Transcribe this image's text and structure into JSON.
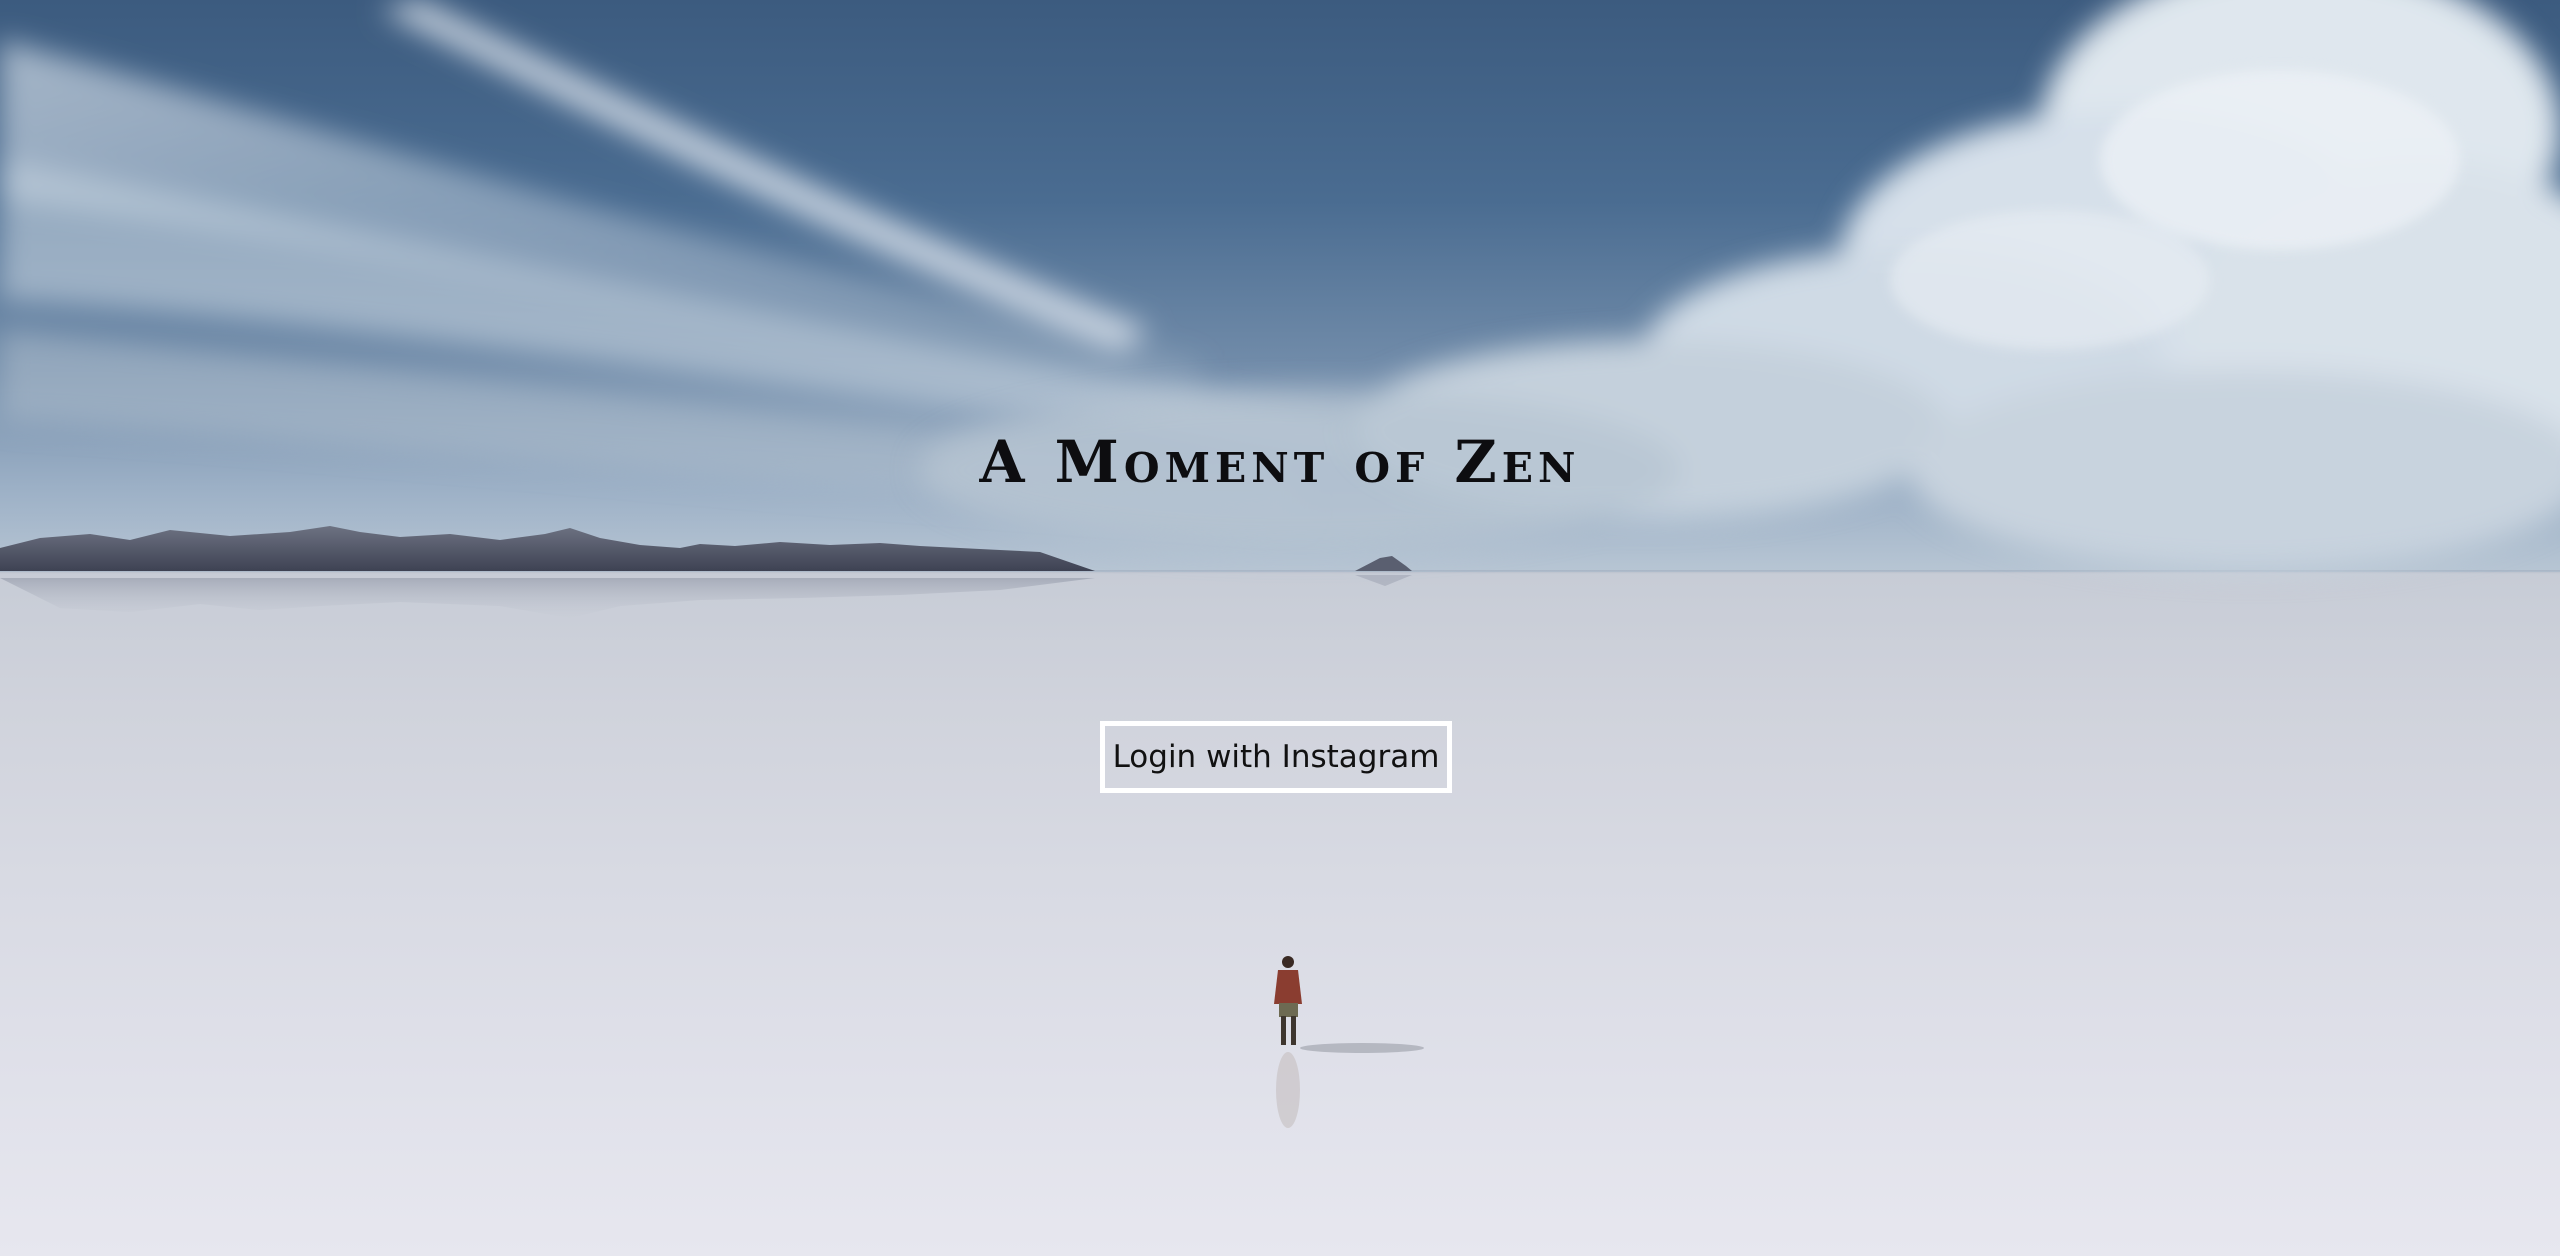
{
  "page": {
    "title": "A Moment of Zen"
  },
  "login": {
    "button_label": "Login with Instagram"
  },
  "scene": {
    "background": "salt-flat-landscape-illustration",
    "figure": "lone-walker-figure"
  },
  "colors": {
    "sky_top": "#3c5b7f",
    "sky_bottom": "#b8c6d4",
    "ground": "#dcdde6",
    "button_border": "#ffffff",
    "title_text": "#0d0d10",
    "figure_jacket": "#8a3d30"
  }
}
